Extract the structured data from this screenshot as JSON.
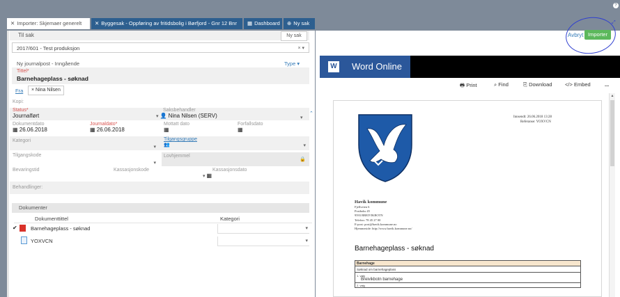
{
  "tabs": [
    {
      "label": "Importer: Skjemaer generelt",
      "active": true
    },
    {
      "label": "Byggesak - Oppføring av fritidsbolig i Børfjord - Gnr 12 Bnr",
      "active": false
    },
    {
      "label": "Dashboard",
      "active": false
    },
    {
      "label": "Ny sak",
      "active": false
    }
  ],
  "header_actions": {
    "cancel": "Avbryt",
    "import": "Importer"
  },
  "case": {
    "section_label": "Til sak",
    "new_case_button": "Ny sak",
    "selected": "2017/601 - Test produksjon"
  },
  "journal": {
    "heading": "Ny journalpost - Inngående",
    "type_link": "Type",
    "title_label": "Tittel*",
    "title_value": "Barnehageplass - søknad",
    "from_link": "Fra",
    "from_chip": "Nina Nilsen",
    "copy_label": "Kopi:",
    "status_label": "Status*",
    "status_value": "Journalført",
    "case_officer_label": "Saksbehandler",
    "case_officer_value": "Nina Nilsen (SERV)",
    "doc_date_label": "Dokumentdato",
    "doc_date_value": "26.06.2018",
    "journal_date_label": "Journaldato*",
    "journal_date_value": "26.06.2018",
    "received_date_label": "Mottatt dato",
    "due_date_label": "Forfallsdato",
    "category_label": "Kategori",
    "access_group_link": "Tilgangsgruppe",
    "access_code_label": "Tilgangskode",
    "legal_basis_label": "Lovhjemmel",
    "retention_label": "Bevaringstid",
    "disposal_code_label": "Kassasjonskode",
    "disposal_date_label": "Kassasjonsdato",
    "handling_label": "Behandlinger:"
  },
  "documents": {
    "section_label": "Dokumenter",
    "col_title": "Dokumenttittel",
    "col_category": "Kategori",
    "rows": [
      {
        "title": "Barnehageplass - søknad",
        "type": "pdf"
      },
      {
        "title": "YOXVCN",
        "type": "file"
      }
    ]
  },
  "word_online": {
    "app_name": "Word Online",
    "toolbar": {
      "print": "Print",
      "find": "Find",
      "download": "Download",
      "embed": "Embed",
      "more": "..."
    }
  },
  "document_preview": {
    "received": "Innsendt: 26.06.2018 13:28",
    "reference": "Referanse: YOXVCN",
    "org_name": "Havik kommune",
    "address_lines": [
      "Fjellveien 6",
      "Postboks 45",
      "9593 BREIVIKBOTN",
      "Telefon: 78 45 27 00",
      "E-post: post@havik.kommune.no",
      "Hjemmeside: http://www.havik.kommune.no/"
    ],
    "title": "Barnehageplass - søknad",
    "table_header": "Barnehage",
    "table_row1": "Søknad om barnehageplass",
    "choice1_label": "1. valg",
    "choice1_value": "Breivikbotn barnehage",
    "choice2_label": "2. valg"
  },
  "colors": {
    "accent": "#2d5f8f",
    "import_green": "#5cb85c",
    "word_blue": "#2b579a",
    "required_red": "#d9534f",
    "annotation_blue": "#2f3fd0"
  }
}
